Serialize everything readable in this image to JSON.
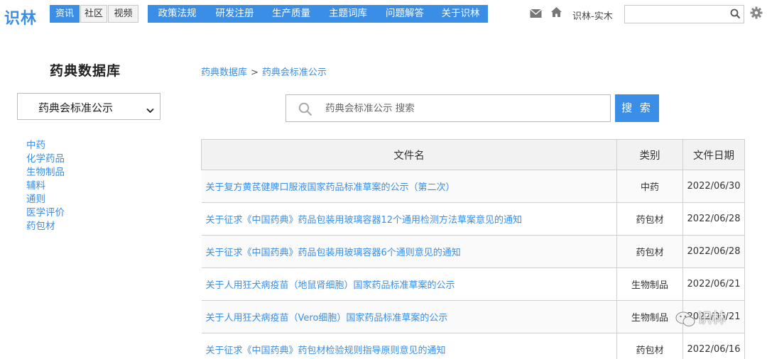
{
  "brand": {
    "logo": "识林"
  },
  "content_tabs": [
    "资讯",
    "社区",
    "视频"
  ],
  "main_nav": [
    "政策法规",
    "研发注册",
    "生产质量",
    "主题词库",
    "问题解答",
    "关于识林"
  ],
  "user": {
    "name": "识林-实木"
  },
  "top_search": {
    "value": ""
  },
  "sidebar": {
    "title": "药典数据库",
    "selected": "药典会标准公示",
    "categories": [
      "中药",
      "化学药品",
      "生物制品",
      "辅料",
      "通则",
      "医学评价",
      "药包材"
    ]
  },
  "breadcrumb": {
    "root": "药典数据库",
    "separator": ">",
    "current": "药典会标准公示"
  },
  "search": {
    "placeholder": "药典会标准公示 搜索",
    "button": "搜 索"
  },
  "table": {
    "headers": [
      "文件名",
      "类别",
      "文件日期"
    ],
    "rows": [
      {
        "title": "关于复方黄芪健脾口服液国家药品标准草案的公示（第二次）",
        "category": "中药",
        "date": "2022/06/30"
      },
      {
        "title": "关于征求《中国药典》药品包装用玻璃容器12个通用检测方法草案意见的通知",
        "category": "药包材",
        "date": "2022/06/28"
      },
      {
        "title": "关于征求《中国药典》药品包装用玻璃容器6个通则意见的通知",
        "category": "药包材",
        "date": "2022/06/28"
      },
      {
        "title": "关于人用狂犬病疫苗（地鼠肾细胞）国家药品标准草案的公示",
        "category": "生物制品",
        "date": "2022/06/21"
      },
      {
        "title": "关于人用狂犬病疫苗（Vero细胞）国家药品标准草案的公示",
        "category": "生物制品",
        "date": "2022/06/21"
      },
      {
        "title": "关于征求《中国药典》药包材检验规则指导原则意见的通知",
        "category": "药包材",
        "date": "2022/06/16"
      }
    ]
  },
  "watermark": "识林",
  "icons": [
    "mail-icon",
    "home-icon",
    "search-icon",
    "gear-icon",
    "chevron-down-icon",
    "wechat-icon"
  ],
  "colors": {
    "accent": "#3a8ee6",
    "header_bg": "#f2f2f2"
  }
}
